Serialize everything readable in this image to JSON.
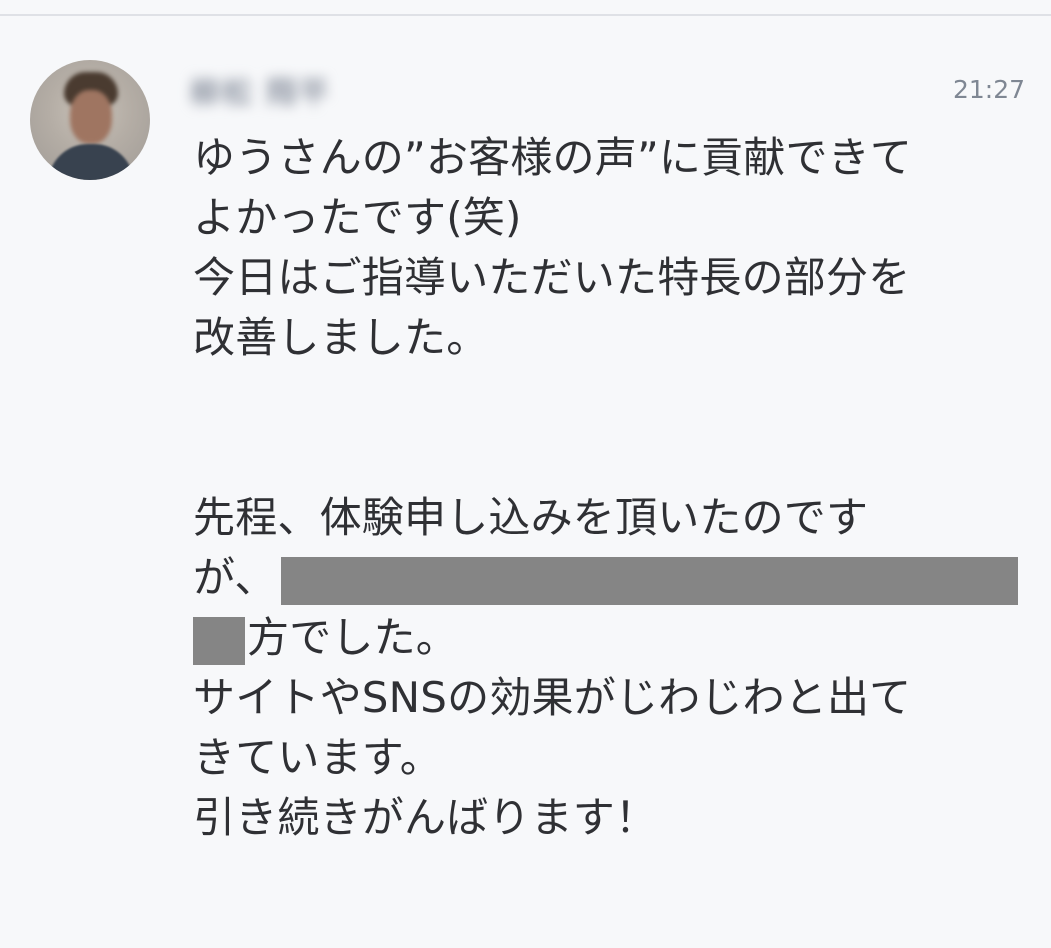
{
  "message": {
    "sender_name": "柳松 翔平",
    "time": "21:27",
    "lines": [
      "ゆうさんの”お客様の声”に貢献できて",
      "よかったです(笑)",
      "今日はご指導いただいた特長の部分を",
      "改善しました。",
      "先程、体験申し込みを頂いたのです",
      "が、",
      "方でした。",
      "サイトやSNSの効果がじわじわと出て",
      "きています。",
      "引き続きがんばります！"
    ]
  }
}
